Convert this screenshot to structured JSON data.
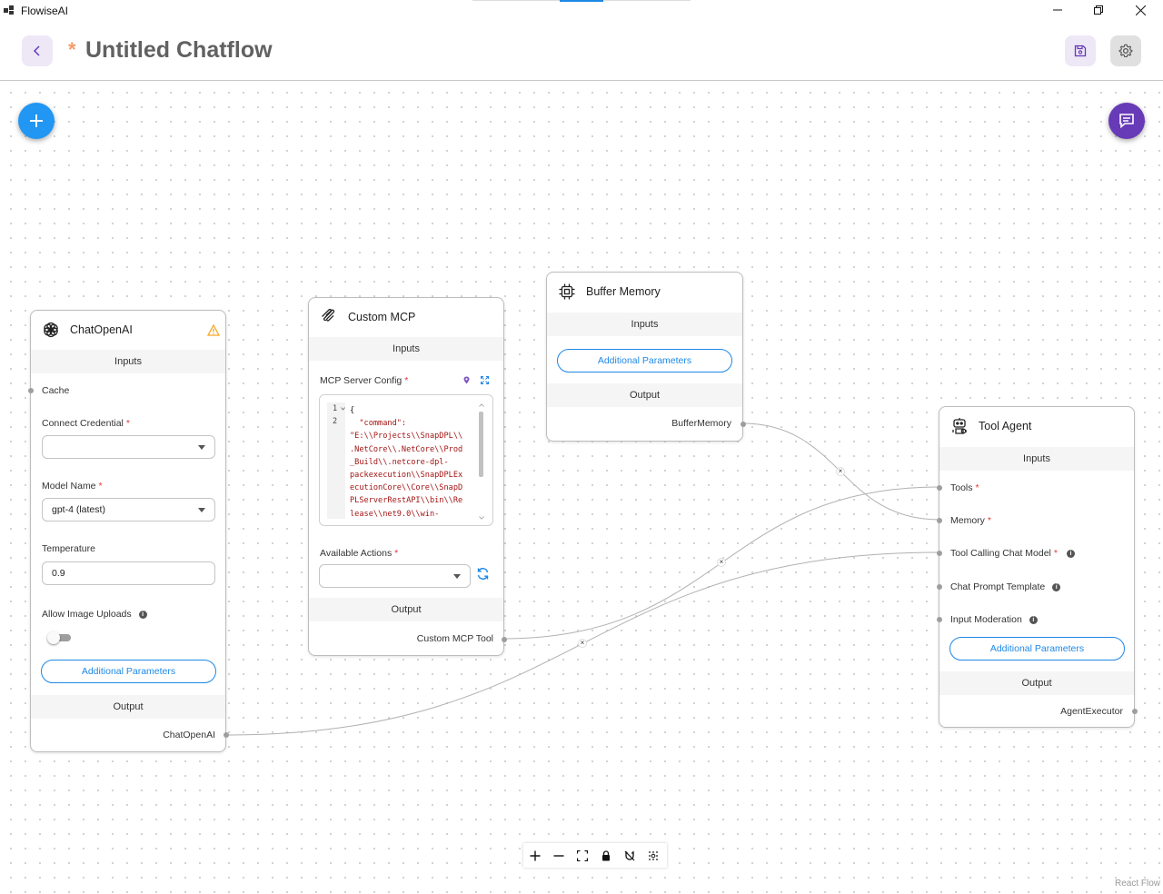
{
  "window": {
    "app_title": "FlowiseAI"
  },
  "header": {
    "unsaved_marker": "*",
    "title": "Untitled Chatflow"
  },
  "nodes": {
    "chat_openai": {
      "title": "ChatOpenAI",
      "inputs_label": "Inputs",
      "cache_label": "Cache",
      "credential_label": "Connect Credential",
      "credential_value": "",
      "model_label": "Model Name",
      "model_value": "gpt-4 (latest)",
      "temperature_label": "Temperature",
      "temperature_value": "0.9",
      "image_uploads_label": "Allow Image Uploads",
      "image_uploads_enabled": false,
      "additional_label": "Additional Parameters",
      "output_label": "Output",
      "output_name": "ChatOpenAI"
    },
    "custom_mcp": {
      "title": "Custom MCP",
      "inputs_label": "Inputs",
      "config_label": "MCP Server Config",
      "code_lines": [
        "{",
        "  \"command\":",
        "\"E:\\\\Projects\\\\SnapDPL\\\\",
        ".NetCore\\\\.NetCore\\\\Prod",
        "_Build\\\\.netcore-dpl-",
        "packexecution\\\\SnapDPLEx",
        "ecutionCore\\\\Core\\\\SnapD",
        "PLServerRestAPI\\\\bin\\\\Re",
        "lease\\\\net9.0\\\\win-"
      ],
      "line_numbers": [
        "1",
        "2"
      ],
      "actions_label": "Available Actions",
      "actions_value": "",
      "output_label": "Output",
      "output_name": "Custom MCP Tool"
    },
    "buffer_memory": {
      "title": "Buffer Memory",
      "inputs_label": "Inputs",
      "additional_label": "Additional Parameters",
      "output_label": "Output",
      "output_name": "BufferMemory"
    },
    "tool_agent": {
      "title": "Tool Agent",
      "inputs_label": "Inputs",
      "tools_label": "Tools",
      "memory_label": "Memory",
      "chat_model_label": "Tool Calling Chat Model",
      "prompt_label": "Chat Prompt Template",
      "moderation_label": "Input Moderation",
      "additional_label": "Additional Parameters",
      "output_label": "Output",
      "output_name": "AgentExecutor"
    }
  },
  "canvas": {
    "attribution": "React Flow",
    "edge_delete_glyph": "×"
  },
  "colors": {
    "primary": "#2196f3",
    "secondary": "#673ab7",
    "required": "#e53935",
    "warning": "#f5a623",
    "unsaved": "#f59b6a"
  }
}
